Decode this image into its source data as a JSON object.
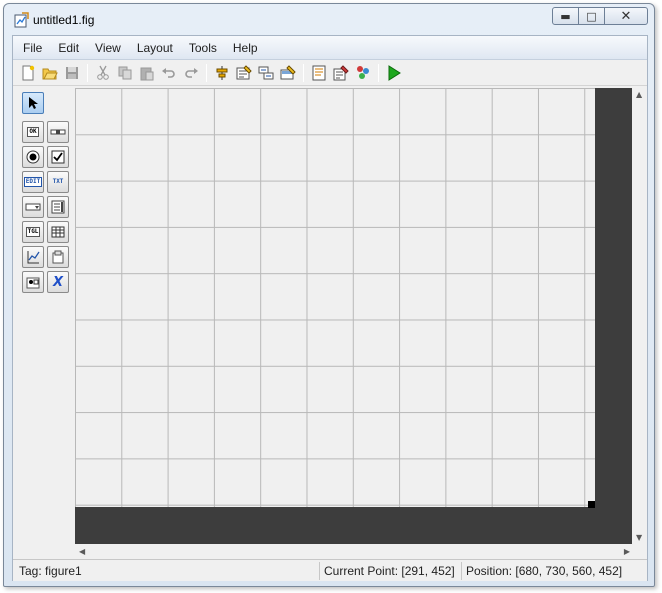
{
  "window": {
    "title": "untitled1.fig"
  },
  "menu": [
    "File",
    "Edit",
    "View",
    "Layout",
    "Tools",
    "Help"
  ],
  "toolbar": [
    "new-file-icon",
    "open-folder-icon",
    "save-icon",
    "cut-icon",
    "copy-icon",
    "paste-icon",
    "undo-icon",
    "redo-icon",
    "align-objects-icon",
    "menu-editor-icon",
    "tab-order-editor-icon",
    "toolbar-editor-icon",
    "m-file-editor-icon",
    "property-inspector-icon",
    "object-browser-icon",
    "run-figure-icon"
  ],
  "palette": [
    {
      "name": "select-tool",
      "label": ""
    },
    {
      "name": "push-button-tool",
      "label": "OK"
    },
    {
      "name": "slider-tool",
      "label": ""
    },
    {
      "name": "radio-button-tool",
      "label": ""
    },
    {
      "name": "checkbox-tool",
      "label": ""
    },
    {
      "name": "edit-text-tool",
      "label": "EDIT"
    },
    {
      "name": "static-text-tool",
      "label": "TXT"
    },
    {
      "name": "popup-menu-tool",
      "label": ""
    },
    {
      "name": "listbox-tool",
      "label": ""
    },
    {
      "name": "toggle-button-tool",
      "label": "TGL"
    },
    {
      "name": "table-tool",
      "label": ""
    },
    {
      "name": "axes-tool",
      "label": ""
    },
    {
      "name": "panel-tool",
      "label": ""
    },
    {
      "name": "button-group-tool",
      "label": ""
    },
    {
      "name": "activex-control-tool",
      "label": "X"
    }
  ],
  "status": {
    "tag": "Tag: figure1",
    "current_point": "Current Point:  [291, 452]",
    "position": "Position: [680, 730, 560, 452]"
  },
  "colors": {
    "canvas_background": "#3d3d3d",
    "grid_background": "#f0f0f0",
    "run_green": "#1fa81f"
  }
}
